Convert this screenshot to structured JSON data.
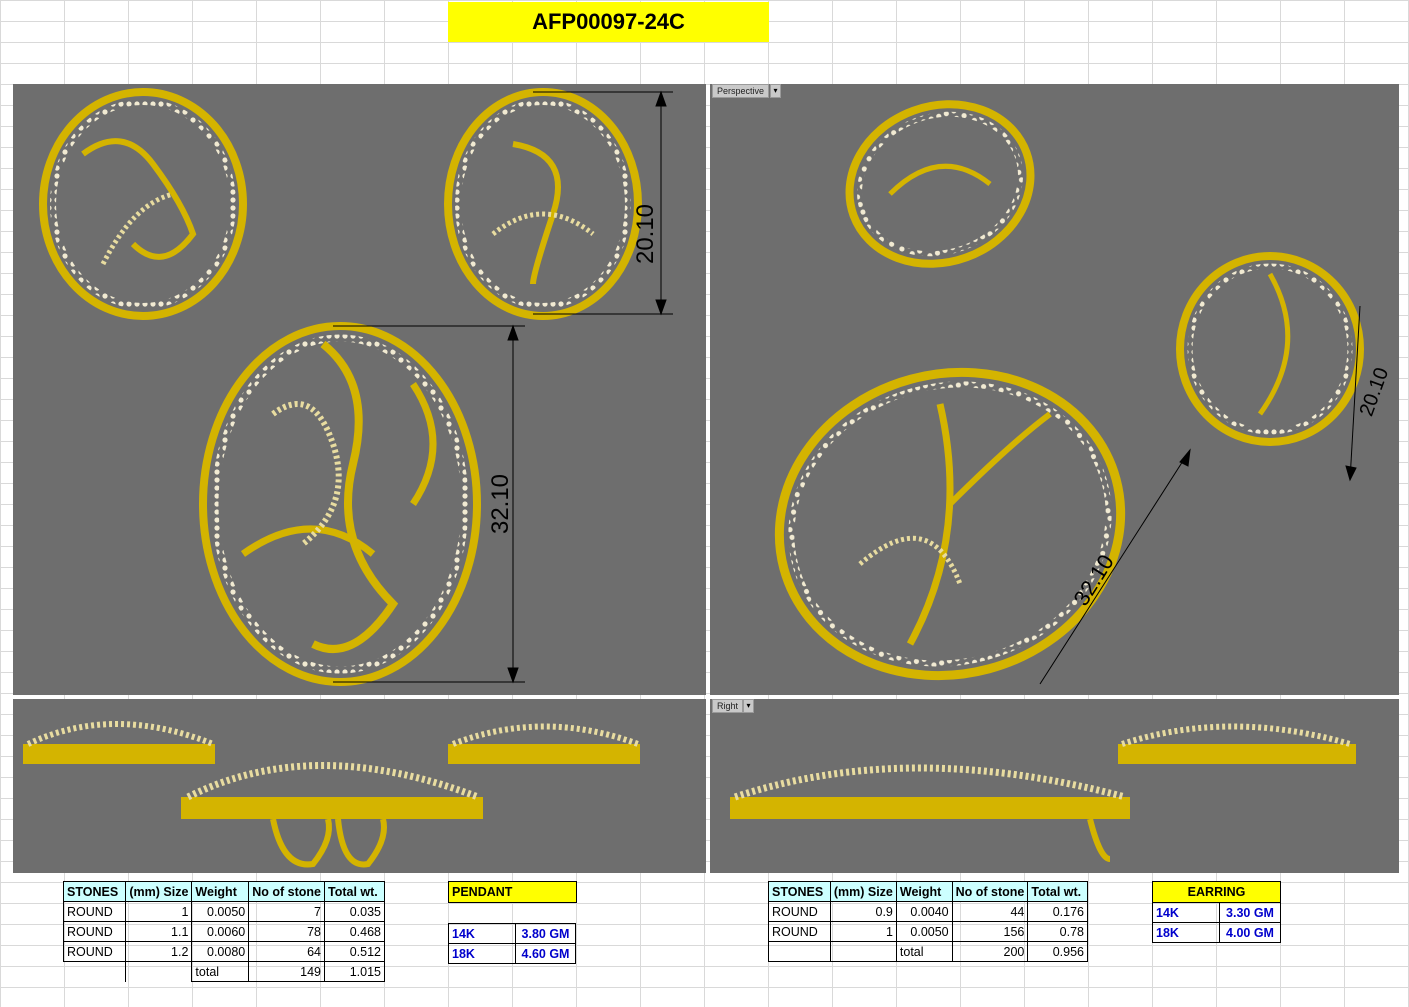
{
  "title": "AFP00097-24C",
  "viewports": {
    "perspective_label": "Perspective",
    "right_label": "Right"
  },
  "dimensions": {
    "earring_height": "20.10",
    "pendant_height": "32.10"
  },
  "pendant_stones": {
    "headers": [
      "STONES",
      "(mm) Size",
      "Weight",
      "No of stone",
      "Total wt."
    ],
    "rows": [
      [
        "ROUND",
        "1",
        "0.0050",
        "7",
        "0.035"
      ],
      [
        "ROUND",
        "1.1",
        "0.0060",
        "78",
        "0.468"
      ],
      [
        "ROUND",
        "1.2",
        "0.0080",
        "64",
        "0.512"
      ]
    ],
    "total_label": "total",
    "total_count": "149",
    "total_weight": "1.015"
  },
  "pendant_metal": {
    "label": "PENDANT",
    "rows": [
      [
        "14K",
        "3.80 GM"
      ],
      [
        "18K",
        "4.60 GM"
      ]
    ]
  },
  "earring_stones": {
    "headers": [
      "STONES",
      "(mm) Size",
      "Weight",
      "No of stone",
      "Total wt."
    ],
    "rows": [
      [
        "ROUND",
        "0.9",
        "0.0040",
        "44",
        "0.176"
      ],
      [
        "ROUND",
        "1",
        "0.0050",
        "156",
        "0.78"
      ]
    ],
    "total_label": "total",
    "total_count": "200",
    "total_weight": "0.956"
  },
  "earring_metal": {
    "label": "EARRING",
    "rows": [
      [
        "14K",
        "3.30 GM"
      ],
      [
        "18K",
        "4.00 GM"
      ]
    ]
  },
  "colors": {
    "gold": "#d4b400",
    "gold_dark": "#8a7200",
    "viewport_bg": "#6e6e6e",
    "title_bg": "#ffff00",
    "metal_text": "#0000cc"
  }
}
